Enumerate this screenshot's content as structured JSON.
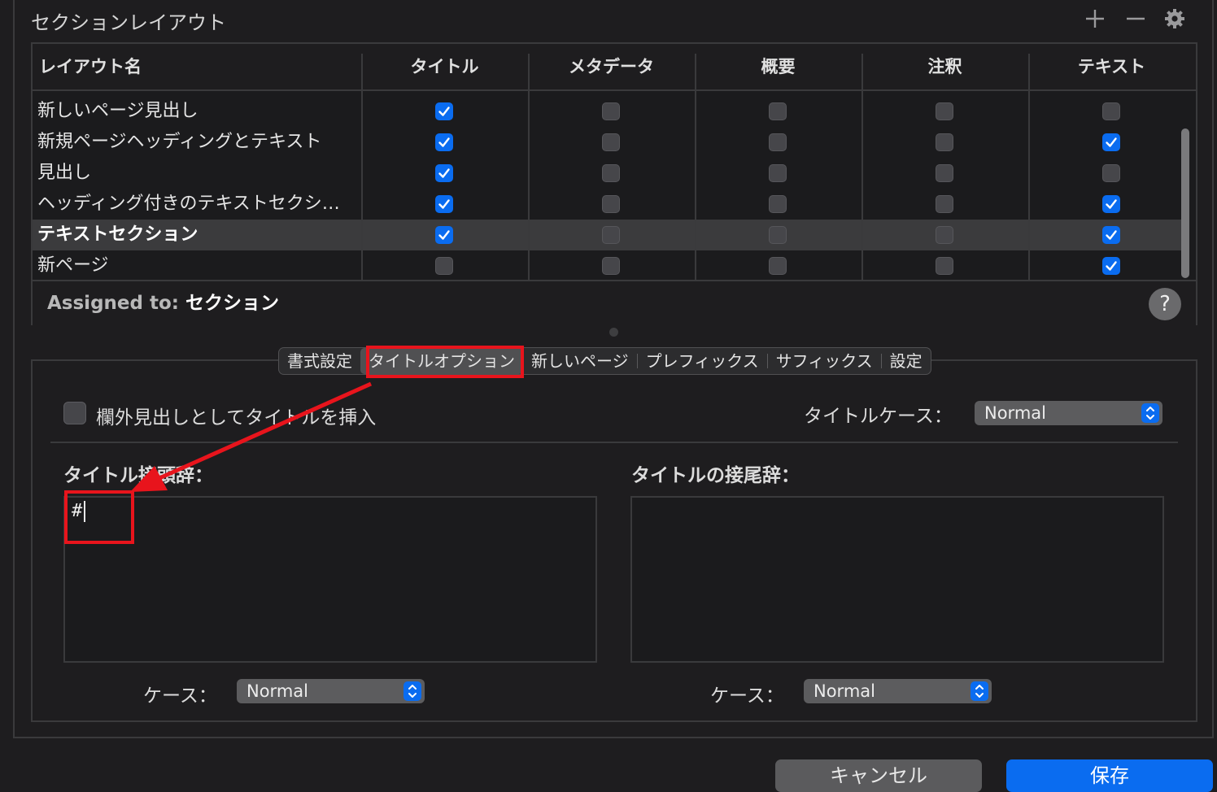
{
  "header": {
    "title": "セクションレイアウト"
  },
  "toolbar": {
    "icons": [
      "plus-icon",
      "minus-icon",
      "gear-icon"
    ]
  },
  "table": {
    "columns": [
      "レイアウト名",
      "タイトル",
      "メタデータ",
      "概要",
      "注釈",
      "テキスト"
    ],
    "rows": [
      {
        "name": "新しいページ見出し",
        "checks": [
          true,
          false,
          false,
          false,
          false
        ]
      },
      {
        "name": "新規ページヘッディングとテキスト",
        "checks": [
          true,
          false,
          false,
          false,
          true
        ]
      },
      {
        "name": "見出し",
        "checks": [
          true,
          false,
          false,
          false,
          false
        ]
      },
      {
        "name": "ヘッディング付きのテキストセクシ…",
        "checks": [
          true,
          false,
          false,
          false,
          true
        ]
      },
      {
        "name": "テキストセクション",
        "checks": [
          true,
          false,
          false,
          false,
          true
        ],
        "selected": true
      },
      {
        "name": "新ページ",
        "checks": [
          false,
          false,
          false,
          false,
          true
        ]
      }
    ]
  },
  "assigned": {
    "label": "Assigned to:",
    "value": "セクション"
  },
  "help": {
    "label": "?"
  },
  "tabs": [
    "書式設定",
    "タイトルオプション",
    "新しいページ",
    "プレフィックス",
    "サフィックス",
    "設定"
  ],
  "active_tab": "タイトルオプション",
  "options": {
    "insert_title_label": "欄外見出しとしてタイトルを挿入",
    "title_case_label": "タイトルケース：",
    "title_case_value": "Normal"
  },
  "prefix": {
    "label": "タイトル接頭辞：",
    "value": "#",
    "case_label": "ケース：",
    "case_value": "Normal"
  },
  "suffix": {
    "label": "タイトルの接尾辞：",
    "value": "",
    "case_label": "ケース：",
    "case_value": "Normal"
  },
  "buttons": {
    "cancel": "キャンセル",
    "save": "保存"
  },
  "colors": {
    "accent": "#0a6cf0",
    "annotation": "#e8141c",
    "background": "#1e1d1f"
  }
}
